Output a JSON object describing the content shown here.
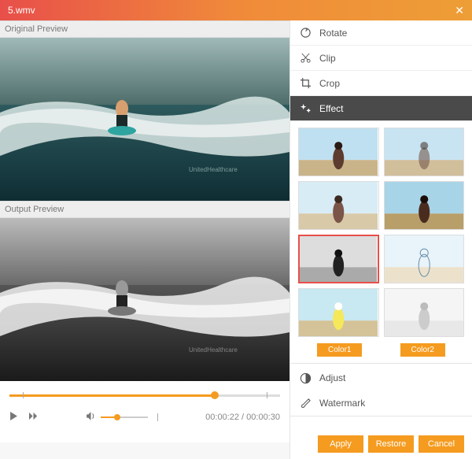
{
  "titlebar": {
    "filename": "5.wmv"
  },
  "left": {
    "original_label": "Original Preview",
    "output_label": "Output Preview",
    "time_current": "00:00:22",
    "time_total": "00:00:30"
  },
  "tools": {
    "rotate": "Rotate",
    "clip": "Clip",
    "crop": "Crop",
    "effect": "Effect",
    "adjust": "Adjust",
    "watermark": "Watermark"
  },
  "effects": {
    "color1": "Color1",
    "color2": "Color2"
  },
  "footer": {
    "apply": "Apply",
    "restore": "Restore",
    "cancel": "Cancel"
  }
}
